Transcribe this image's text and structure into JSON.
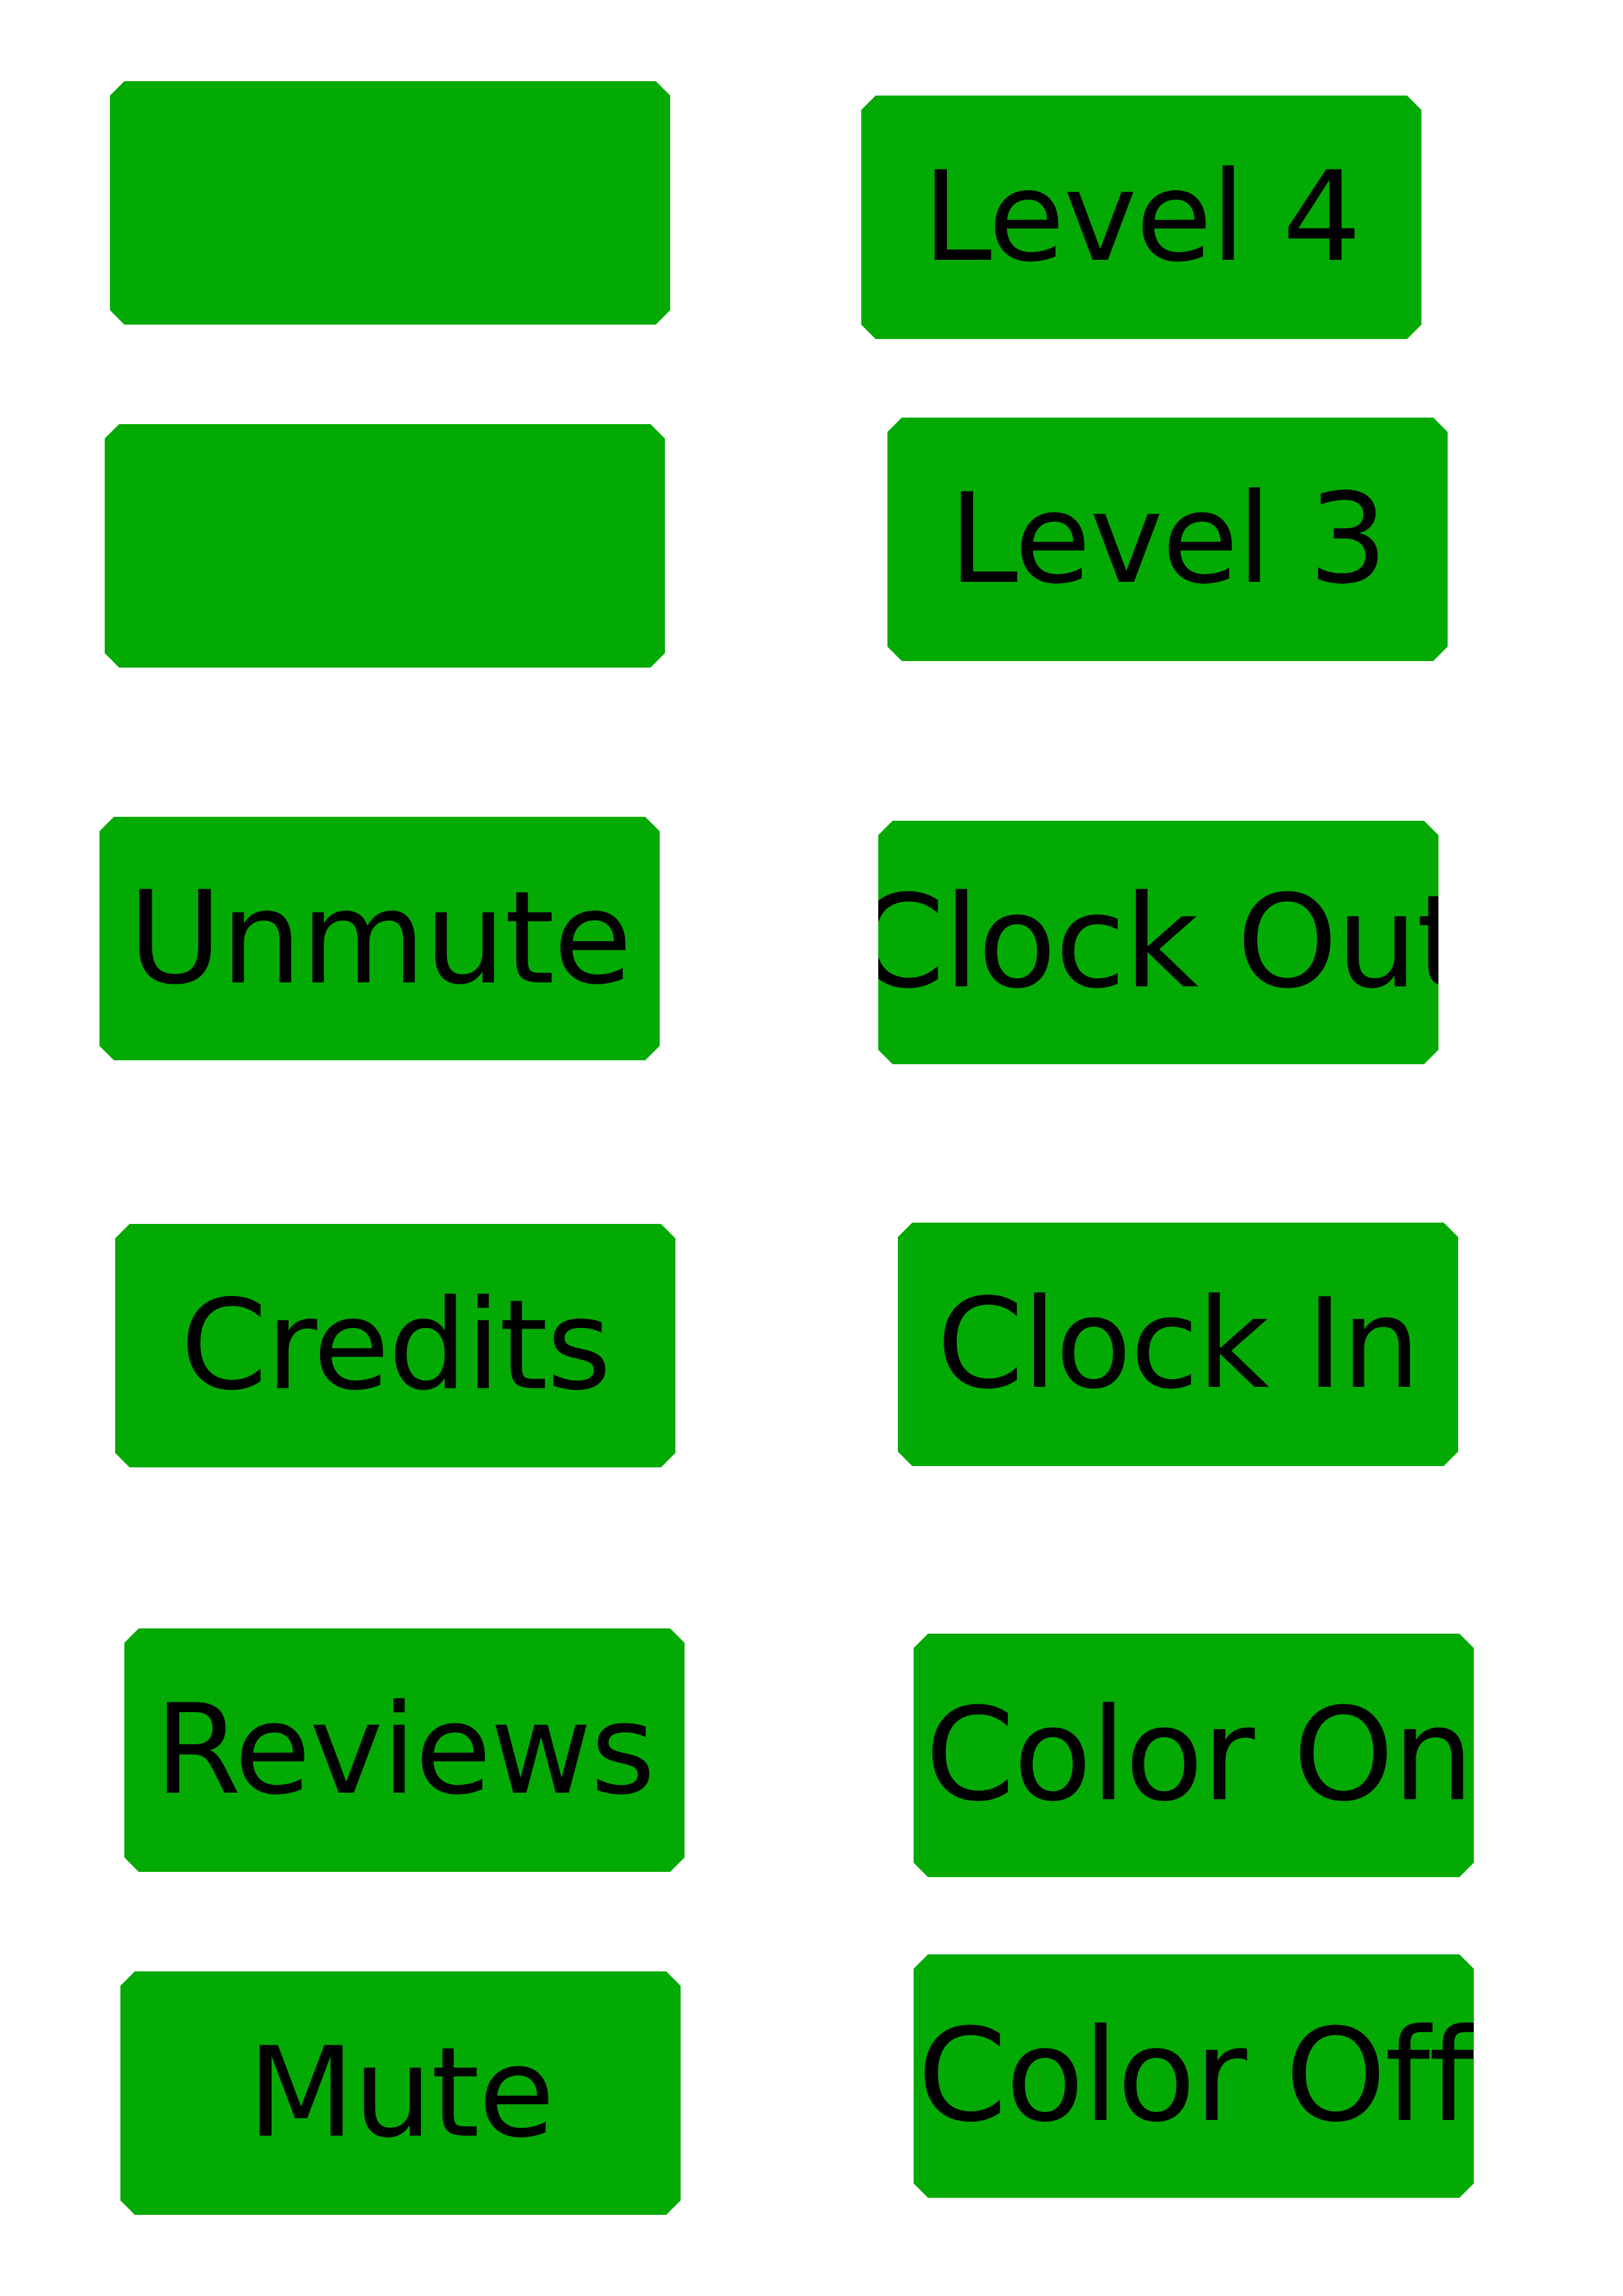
{
  "buttons_left": [
    {
      "label": ""
    },
    {
      "label": ""
    },
    {
      "label": "Unmute"
    },
    {
      "label": "Credits"
    },
    {
      "label": "Reviews"
    },
    {
      "label": "Mute"
    }
  ],
  "buttons_right": [
    {
      "label": "Level 4"
    },
    {
      "label": "Level 3"
    },
    {
      "label": "Clock Out"
    },
    {
      "label": "Clock In"
    },
    {
      "label": "Color On"
    },
    {
      "label": "Color Off"
    }
  ],
  "colors": {
    "button_fill": "#04aa04",
    "label_text": "#000000",
    "background": "#ffffff"
  }
}
